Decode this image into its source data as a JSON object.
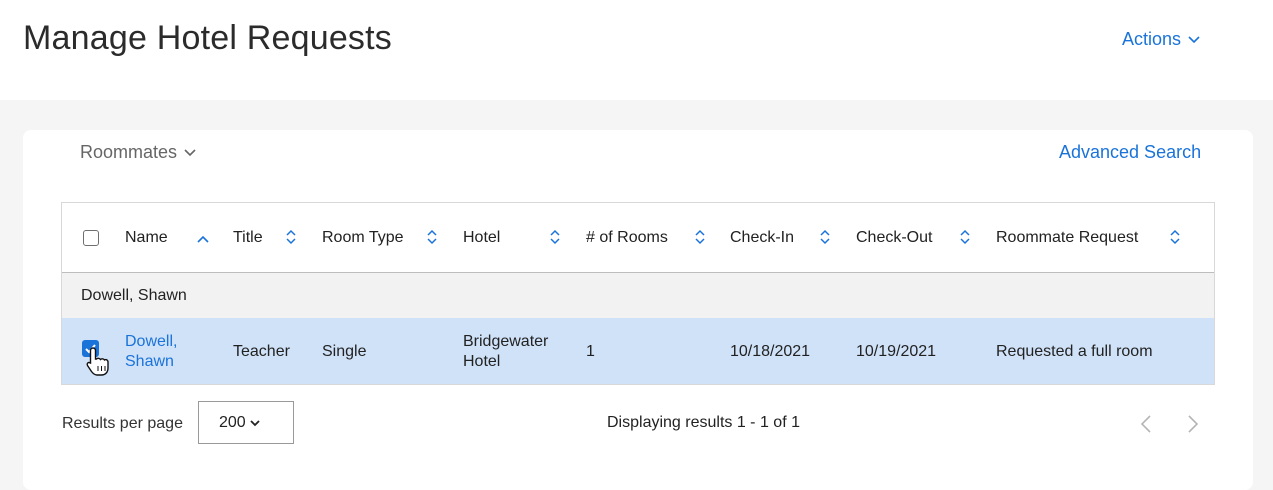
{
  "header": {
    "title": "Manage Hotel Requests",
    "actions_label": "Actions"
  },
  "filters": {
    "view_label": "Roommates",
    "advanced_search_label": "Advanced Search"
  },
  "table": {
    "columns": [
      "Name",
      "Title",
      "Room Type",
      "Hotel",
      "# of Rooms",
      "Check-In",
      "Check-Out",
      "Roommate Request"
    ],
    "group_label": "Dowell, Shawn",
    "rows": [
      {
        "name_line1": "Dowell,",
        "name_line2": "Shawn",
        "title": "Teacher",
        "room_type": "Single",
        "hotel_line1": "Bridgewater",
        "hotel_line2": "Hotel",
        "rooms": "1",
        "check_in": "10/18/2021",
        "check_out": "10/19/2021",
        "roommate_request": "Requested a full room",
        "selected": true
      }
    ]
  },
  "footer": {
    "results_per_page_label": "Results per page",
    "results_per_page_value": "200",
    "display_text": "Displaying results 1 - 1 of 1"
  },
  "colors": {
    "accent": "#1a73d9",
    "selected_row": "#d0e2f8",
    "group_row": "#f2f2f2"
  },
  "icons": [
    "chevron-down-icon",
    "sort-asc-icon",
    "sort-both-icon",
    "checkbox-icon",
    "hand-pointer-icon",
    "chevron-left-icon",
    "chevron-right-icon"
  ]
}
